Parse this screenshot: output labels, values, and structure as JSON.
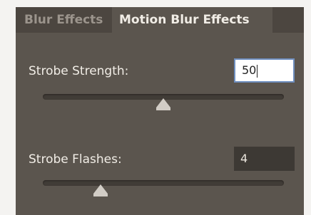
{
  "tabs": [
    {
      "label": "Blur Effects",
      "active": false
    },
    {
      "label": "Motion Blur Effects",
      "active": true
    }
  ],
  "strobe_strength": {
    "label": "Strobe Strength:",
    "value": "50",
    "slider_fraction": 0.5,
    "focused": true
  },
  "strobe_flashes": {
    "label": "Strobe Flashes:",
    "value": "4",
    "slider_fraction": 0.24
  },
  "colors": {
    "panel": "#5b554e",
    "inactive_tab": "#4c4640",
    "text": "#f1ede6",
    "focus_border": "#6f8fbf"
  }
}
